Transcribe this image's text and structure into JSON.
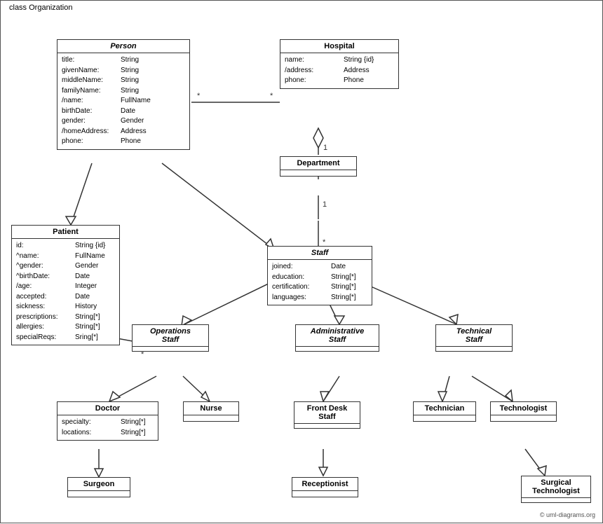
{
  "diagram": {
    "title": "class Organization",
    "classes": {
      "person": {
        "name": "Person",
        "italic": true,
        "attrs": [
          [
            "title:",
            "String"
          ],
          [
            "givenName:",
            "String"
          ],
          [
            "middleName:",
            "String"
          ],
          [
            "familyName:",
            "String"
          ],
          [
            "/name:",
            "FullName"
          ],
          [
            "birthDate:",
            "Date"
          ],
          [
            "gender:",
            "Gender"
          ],
          [
            "/homeAddress:",
            "Address"
          ],
          [
            "phone:",
            "Phone"
          ]
        ]
      },
      "hospital": {
        "name": "Hospital",
        "italic": false,
        "attrs": [
          [
            "name:",
            "String {id}"
          ],
          [
            "/address:",
            "Address"
          ],
          [
            "phone:",
            "Phone"
          ]
        ]
      },
      "department": {
        "name": "Department",
        "italic": false,
        "attrs": []
      },
      "staff": {
        "name": "Staff",
        "italic": true,
        "attrs": [
          [
            "joined:",
            "Date"
          ],
          [
            "education:",
            "String[*]"
          ],
          [
            "certification:",
            "String[*]"
          ],
          [
            "languages:",
            "String[*]"
          ]
        ]
      },
      "patient": {
        "name": "Patient",
        "italic": false,
        "attrs": [
          [
            "id:",
            "String {id}"
          ],
          [
            "^name:",
            "FullName"
          ],
          [
            "^gender:",
            "Gender"
          ],
          [
            "^birthDate:",
            "Date"
          ],
          [
            "/age:",
            "Integer"
          ],
          [
            "accepted:",
            "Date"
          ],
          [
            "sickness:",
            "History"
          ],
          [
            "prescriptions:",
            "String[*]"
          ],
          [
            "allergies:",
            "String[*]"
          ],
          [
            "specialReqs:",
            "Sring[*]"
          ]
        ]
      },
      "operationsStaff": {
        "name": "Operations\nStaff",
        "italic": true,
        "attrs": []
      },
      "adminStaff": {
        "name": "Administrative\nStaff",
        "italic": true,
        "attrs": []
      },
      "technicalStaff": {
        "name": "Technical\nStaff",
        "italic": true,
        "attrs": []
      },
      "doctor": {
        "name": "Doctor",
        "italic": false,
        "attrs": [
          [
            "specialty:",
            "String[*]"
          ],
          [
            "locations:",
            "String[*]"
          ]
        ]
      },
      "nurse": {
        "name": "Nurse",
        "italic": false,
        "attrs": []
      },
      "frontDeskStaff": {
        "name": "Front Desk\nStaff",
        "italic": false,
        "attrs": []
      },
      "technician": {
        "name": "Technician",
        "italic": false,
        "attrs": []
      },
      "technologist": {
        "name": "Technologist",
        "italic": false,
        "attrs": []
      },
      "surgeon": {
        "name": "Surgeon",
        "italic": false,
        "attrs": []
      },
      "receptionist": {
        "name": "Receptionist",
        "italic": false,
        "attrs": []
      },
      "surgicalTechnologist": {
        "name": "Surgical\nTechnologist",
        "italic": false,
        "attrs": []
      }
    },
    "copyright": "© uml-diagrams.org"
  }
}
